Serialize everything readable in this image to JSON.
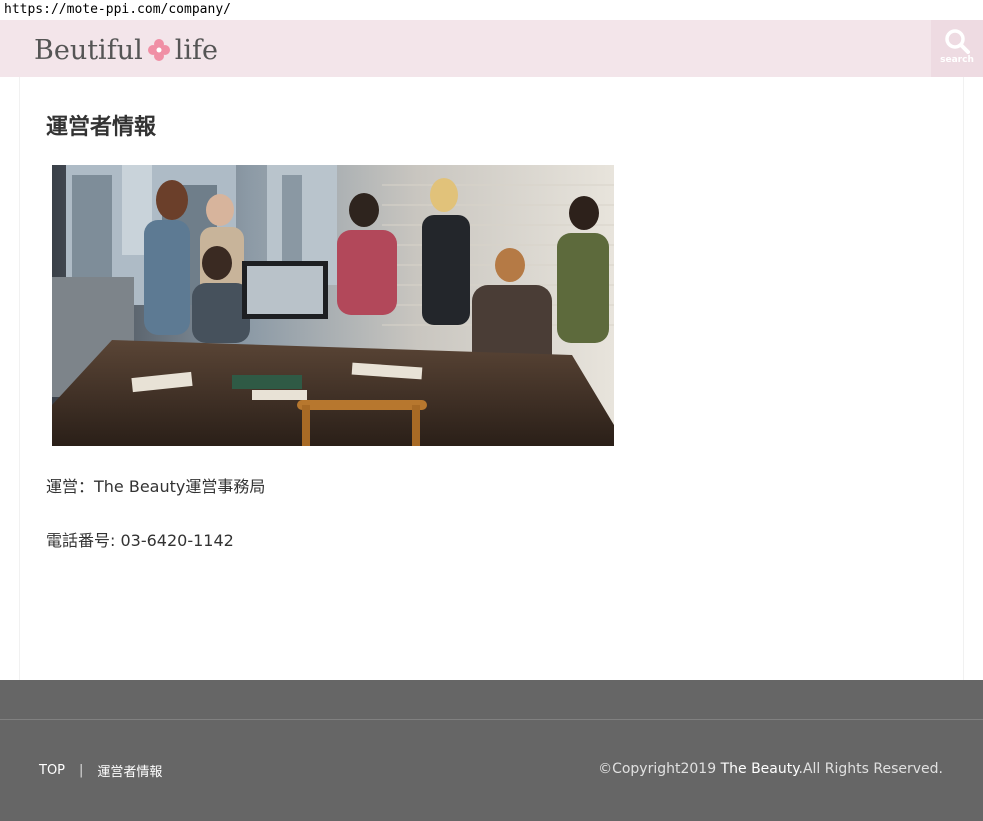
{
  "browser": {
    "url": "https://mote-ppi.com/company/"
  },
  "header": {
    "logo_left": "Beutiful",
    "logo_right": "life",
    "search_label": "search",
    "colors": {
      "bg": "#f3e5ea",
      "flower": "#f08fa5"
    }
  },
  "main": {
    "title": "運営者情報",
    "operator": "運営：The Beauty運営事務局",
    "phone": "電話番号: 03-6420-1142"
  },
  "footer": {
    "nav": [
      {
        "label": "TOP"
      },
      {
        "label": "運営者情報"
      }
    ],
    "separator": "|",
    "copyright_prefix": "©Copyright2019",
    "copyright_brand": "The Beauty",
    "copyright_suffix": ".All Rights Reserved.",
    "colors": {
      "bg": "#666666"
    }
  }
}
